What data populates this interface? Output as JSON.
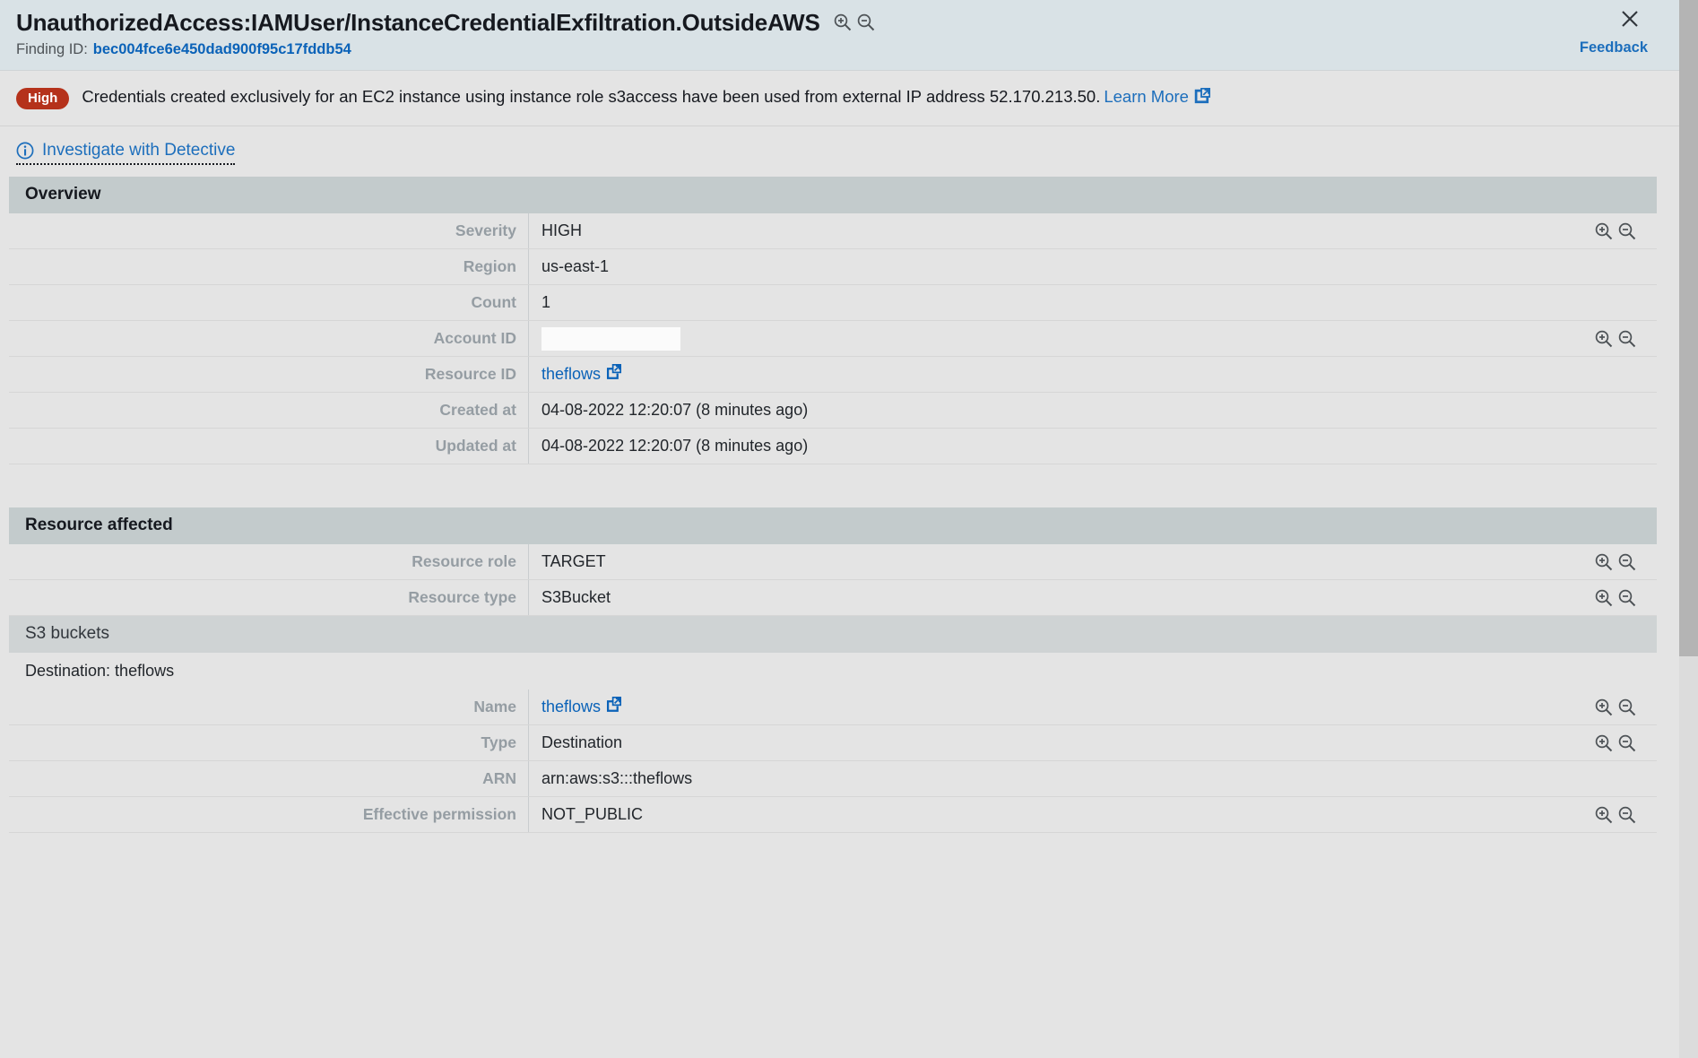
{
  "header": {
    "title": "UnauthorizedAccess:IAMUser/InstanceCredentialExfiltration.OutsideAWS",
    "finding_id_label": "Finding ID:",
    "finding_id_value": "bec004fce6e450dad900f95c17fddb54",
    "feedback_label": "Feedback",
    "close_label": "×",
    "zoom_in_icon": "zoom-in-icon",
    "zoom_out_icon": "zoom-out-icon"
  },
  "severity_banner": {
    "badge": "High",
    "badge_color": "#b5321b",
    "message": "Credentials created exclusively for an EC2 instance using instance role s3access have been used from external IP address 52.170.213.50.",
    "learn_more": "Learn More",
    "external_icon": "external-link-icon"
  },
  "detective": {
    "label": "Investigate with Detective",
    "info_icon": "info-circle-icon"
  },
  "overview": {
    "title": "Overview",
    "rows": [
      {
        "label": "Severity",
        "value": "HIGH",
        "actions": true
      },
      {
        "label": "Region",
        "value": "us-east-1",
        "actions": false
      },
      {
        "label": "Count",
        "value": "1",
        "actions": false
      },
      {
        "label": "Account ID",
        "value": "",
        "redacted": true,
        "actions": true
      },
      {
        "label": "Resource ID",
        "value": "theflows",
        "link": true,
        "actions": false
      },
      {
        "label": "Created at",
        "value": "04-08-2022 12:20:07 (8 minutes ago)",
        "actions": false
      },
      {
        "label": "Updated at",
        "value": "04-08-2022 12:20:07 (8 minutes ago)",
        "actions": false
      }
    ]
  },
  "resource_affected": {
    "title": "Resource affected",
    "rows": [
      {
        "label": "Resource role",
        "value": "TARGET",
        "actions": true
      },
      {
        "label": "Resource type",
        "value": "S3Bucket",
        "actions": true
      }
    ],
    "s3_buckets": {
      "title": "S3 buckets",
      "destination_text": "Destination: theflows",
      "rows": [
        {
          "label": "Name",
          "value": "theflows",
          "link": true,
          "actions": true
        },
        {
          "label": "Type",
          "value": "Destination",
          "actions": true
        },
        {
          "label": "ARN",
          "value": "arn:aws:s3:::theflows",
          "actions": false
        },
        {
          "label": "Effective permission",
          "value": "NOT_PUBLIC",
          "actions": true
        }
      ]
    }
  }
}
